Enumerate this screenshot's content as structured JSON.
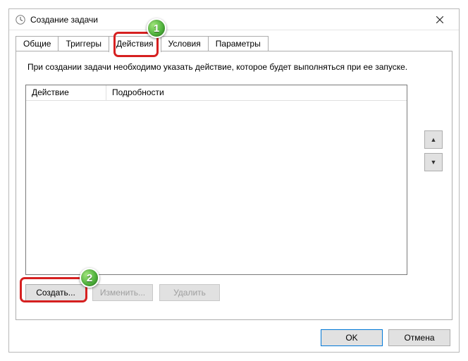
{
  "window": {
    "title": "Создание задачи"
  },
  "tabs": {
    "general": "Общие",
    "triggers": "Триггеры",
    "actions": "Действия",
    "conditions": "Условия",
    "settings": "Параметры"
  },
  "instruction": "При создании задачи необходимо указать действие, которое будет выполняться при ее запуске.",
  "columns": {
    "action": "Действие",
    "details": "Подробности"
  },
  "buttons": {
    "create": "Создать...",
    "edit": "Изменить...",
    "delete": "Удалить",
    "ok": "OK",
    "cancel": "Отмена"
  },
  "badges": {
    "b1": "1",
    "b2": "2"
  }
}
